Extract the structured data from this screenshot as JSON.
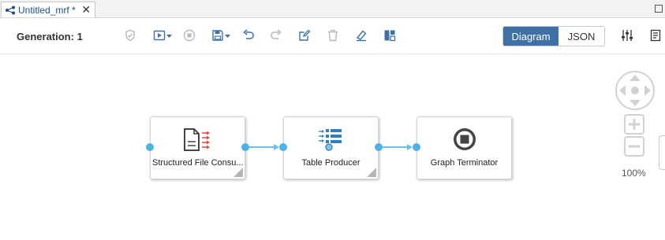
{
  "tab": {
    "title": "Untitled_mrf *",
    "close": "✕"
  },
  "toolbar": {
    "generation_label": "Generation: 1"
  },
  "view_toggle": {
    "diagram": "Diagram",
    "json": "JSON"
  },
  "nodes": [
    {
      "label": "Structured File Consu..."
    },
    {
      "label": "Table Producer"
    },
    {
      "label": "Graph Terminator"
    }
  ],
  "zoom": {
    "level": "100%"
  },
  "colors": {
    "accent": "#3f71a7",
    "port": "#4bb3e6",
    "connection": "#6cc1ea",
    "icon_blue": "#2d7fc1",
    "icon_red": "#e0474c"
  }
}
